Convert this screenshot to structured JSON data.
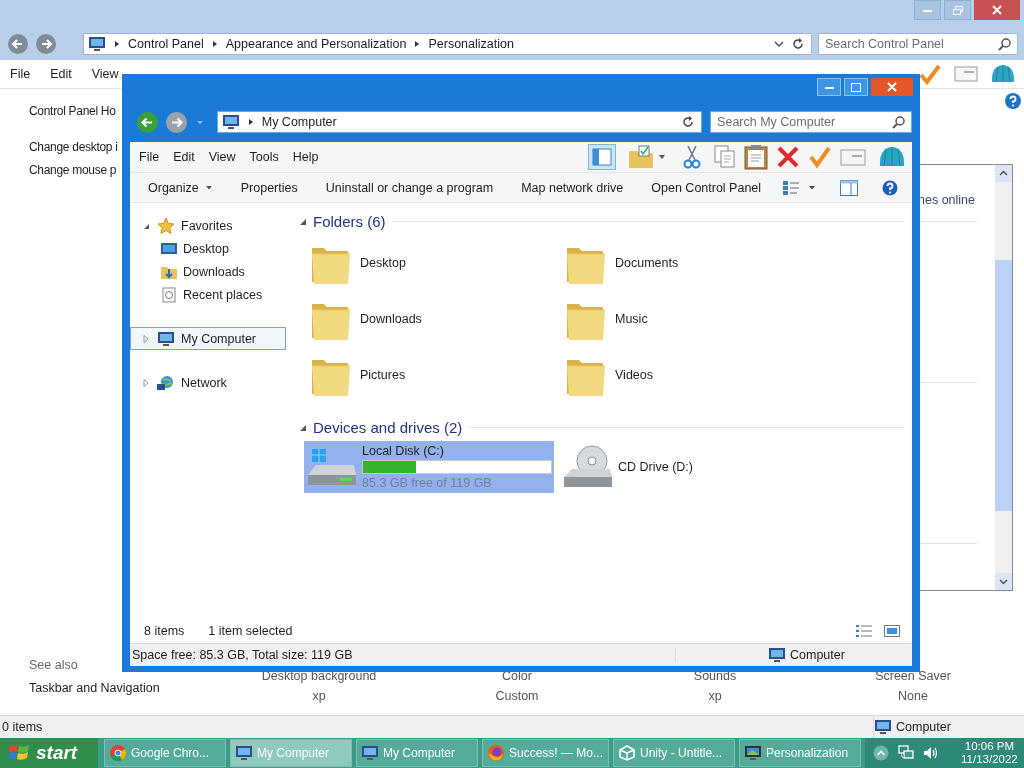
{
  "background_window": {
    "address": [
      "Control Panel",
      "Appearance and Personalization",
      "Personalization"
    ],
    "search": {
      "placeholder": "Search Control Panel"
    },
    "menu": [
      "File",
      "Edit",
      "View"
    ],
    "sidebar": {
      "links": [
        "Control Panel Ho",
        "Change desktop i",
        "Change mouse p"
      ],
      "see_also": "See also",
      "see_also_links": [
        "Taskbar and Navigation"
      ]
    },
    "panel_text": "nes online",
    "themes": [
      {
        "label": "Desktop background",
        "value": "xp"
      },
      {
        "label": "Color",
        "value": "Custom"
      },
      {
        "label": "Sounds",
        "value": "xp"
      },
      {
        "label": "Screen Saver",
        "value": "None"
      }
    ],
    "status_bar": {
      "items": "0 items",
      "location": "Computer"
    }
  },
  "window": {
    "address": "My Computer",
    "search": {
      "placeholder": "Search My Computer"
    },
    "menu": [
      "File",
      "Edit",
      "View",
      "Tools",
      "Help"
    ],
    "commands": [
      {
        "label": "Organize",
        "dropdown": true
      },
      {
        "label": "Properties",
        "dropdown": false
      },
      {
        "label": "Uninstall or change a program",
        "dropdown": false
      },
      {
        "label": "Map network drive",
        "dropdown": false
      },
      {
        "label": "Open Control Panel",
        "dropdown": false
      }
    ],
    "nav": [
      {
        "label": "Favorites",
        "kind": "favorites",
        "expanded": true,
        "selected": false,
        "children": [
          {
            "label": "Desktop",
            "kind": "desktop",
            "selected": false
          },
          {
            "label": "Downloads",
            "kind": "downloads",
            "selected": false
          },
          {
            "label": "Recent places",
            "kind": "recent",
            "selected": false
          }
        ]
      },
      {
        "label": "My Computer",
        "kind": "computer",
        "expanded": false,
        "selected": true
      },
      {
        "label": "Network",
        "kind": "network",
        "expanded": false,
        "selected": false
      }
    ],
    "folders_header": "Folders (6)",
    "folders": [
      {
        "label": "Desktop"
      },
      {
        "label": "Documents"
      },
      {
        "label": "Downloads"
      },
      {
        "label": "Music"
      },
      {
        "label": "Pictures"
      },
      {
        "label": "Videos"
      }
    ],
    "drives_header": "Devices and drives (2)",
    "drives": [
      {
        "name": "Local Disk (C:)",
        "kind": "disk",
        "selected": true,
        "level": 0.28,
        "free": "85.3 GB free of 119 GB"
      },
      {
        "name": "CD Drive (D:)",
        "kind": "cd",
        "selected": false
      }
    ],
    "details": {
      "count": "8 items",
      "selection": "1 item selected"
    },
    "status_bar": {
      "space": "Space free: 85.3 GB, Total size: 119 GB",
      "location": "Computer"
    }
  },
  "taskbar": {
    "start": "start",
    "tasks": [
      {
        "label": "Google Chro...",
        "kind": "chrome",
        "selected": false
      },
      {
        "label": "My Computer",
        "kind": "computer",
        "selected": true
      },
      {
        "label": "My Computer",
        "kind": "computer",
        "selected": false
      },
      {
        "label": "Success! — Mo...",
        "kind": "firefox",
        "selected": false
      },
      {
        "label": "Unity - Untitle...",
        "kind": "unity",
        "selected": false
      },
      {
        "label": "Personalization",
        "kind": "personalization",
        "selected": false
      }
    ],
    "time": "10:06 PM",
    "date": "11/13/2022"
  }
}
